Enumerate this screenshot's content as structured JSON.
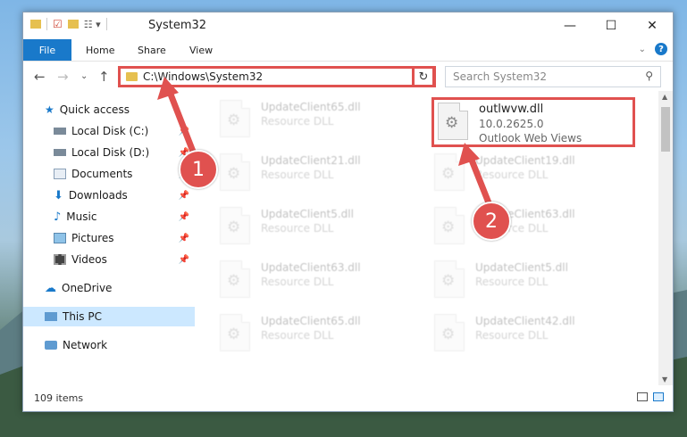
{
  "titlebar": {
    "title": "System32",
    "quick_access_icons": [
      "folder-icon",
      "properties-check-icon",
      "new-folder-icon",
      "customize-icon"
    ]
  },
  "ribbon": {
    "file": "File",
    "home": "Home",
    "share": "Share",
    "view": "View",
    "help": "?"
  },
  "nav": {
    "address": "C:\\Windows\\System32",
    "search_placeholder": "Search System32"
  },
  "sidebar": {
    "items": [
      {
        "label": "Quick access",
        "icon": "star-icon"
      },
      {
        "label": "Local Disk (C:)",
        "icon": "drive-icon"
      },
      {
        "label": "Local Disk (D:)",
        "icon": "drive-icon"
      },
      {
        "label": "Documents",
        "icon": "documents-icon"
      },
      {
        "label": "Downloads",
        "icon": "download-icon"
      },
      {
        "label": "Music",
        "icon": "music-icon"
      },
      {
        "label": "Pictures",
        "icon": "pictures-icon"
      },
      {
        "label": "Videos",
        "icon": "videos-icon"
      },
      {
        "label": "OneDrive",
        "icon": "cloud-icon"
      },
      {
        "label": "This PC",
        "icon": "computer-icon"
      },
      {
        "label": "Network",
        "icon": "network-icon"
      }
    ]
  },
  "files": {
    "left": [
      {
        "name": "UpdateClient65.dll",
        "type": "Resource DLL"
      },
      {
        "name": "UpdateClient21.dll",
        "type": "Resource DLL"
      },
      {
        "name": "UpdateClient5.dll",
        "type": "Resource DLL"
      },
      {
        "name": "UpdateClient63.dll",
        "type": "Resource DLL"
      },
      {
        "name": "UpdateClient65.dll",
        "type": "Resource DLL"
      }
    ],
    "right": [
      {
        "name": "UpdateClient19.dll",
        "type": "Resource DLL"
      },
      {
        "name": "UpdateClient63.dll",
        "type": "Resource DLL"
      },
      {
        "name": "UpdateClient5.dll",
        "type": "Resource DLL"
      },
      {
        "name": "UpdateClient42.dll",
        "type": "Resource DLL"
      }
    ],
    "highlighted": {
      "name": "outlwvw.dll",
      "version": "10.0.2625.0",
      "description": "Outlook Web Views"
    }
  },
  "status": {
    "items": "109 items"
  },
  "callouts": {
    "one": "1",
    "two": "2"
  },
  "colors": {
    "accent": "#1979ca",
    "highlight": "#e0514f"
  }
}
